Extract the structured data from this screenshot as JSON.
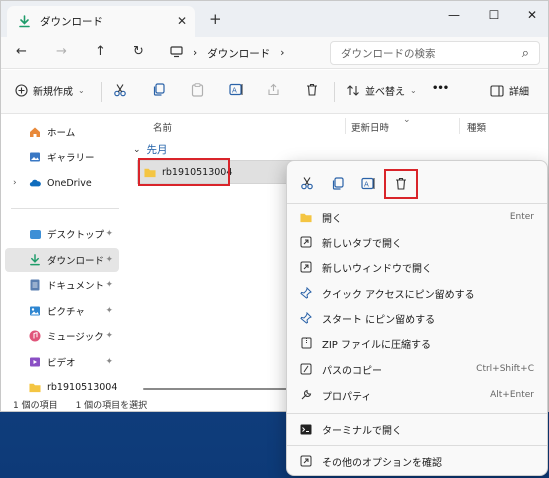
{
  "titlebar": {
    "tab_label": "ダウンロード",
    "tab_close": "✕",
    "new_tab": "+",
    "minimize": "—",
    "maximize": "☐",
    "close": "✕"
  },
  "addressbar": {
    "back": "←",
    "forward": "→",
    "up": "↑",
    "refresh": "↻",
    "crumb_sep1": "›",
    "crumb_location": "ダウンロード",
    "crumb_sep2": "›",
    "search_placeholder": "ダウンロードの検索",
    "search_icon": "⌕"
  },
  "commandbar": {
    "new_label": "新規作成",
    "sort_label": "並べ替え",
    "more": "•••",
    "details_label": "詳細"
  },
  "navpane": {
    "items": [
      {
        "label": "ホーム",
        "icon": "home-icon"
      },
      {
        "label": "ギャラリー",
        "icon": "gallery-icon"
      },
      {
        "label": "OneDrive",
        "icon": "onedrive-icon"
      },
      {
        "label": "デスクトップ",
        "icon": "desktop-icon"
      },
      {
        "label": "ダウンロード",
        "icon": "download-icon"
      },
      {
        "label": "ドキュメント",
        "icon": "documents-icon"
      },
      {
        "label": "ピクチャ",
        "icon": "pictures-icon"
      },
      {
        "label": "ミュージック",
        "icon": "music-icon"
      },
      {
        "label": "ビデオ",
        "icon": "videos-icon"
      },
      {
        "label": "rb1910513004",
        "icon": "folder-icon"
      }
    ],
    "expander": "›",
    "pin": "📌"
  },
  "content": {
    "columns": [
      "名前",
      "更新日時",
      "種類"
    ],
    "group_label": "先月",
    "group_chevron": "⌄",
    "files": [
      {
        "name": "rb1910513004",
        "icon": "folder-icon"
      }
    ]
  },
  "statusbar": {
    "item_count": "1 個の項目",
    "selected": "1 個の項目を選択"
  },
  "context_menu": {
    "quick_actions": [
      "cut-icon",
      "copy-icon",
      "rename-icon",
      "delete-icon"
    ],
    "items": [
      {
        "label": "開く",
        "shortcut": "Enter",
        "icon": "folder-open-icon"
      },
      {
        "label": "新しいタブで開く",
        "shortcut": "",
        "icon": "new-tab-icon"
      },
      {
        "label": "新しいウィンドウで開く",
        "shortcut": "",
        "icon": "new-window-icon"
      },
      {
        "label": "クイック アクセスにピン留めする",
        "shortcut": "",
        "icon": "pin-icon"
      },
      {
        "label": "スタート にピン留めする",
        "shortcut": "",
        "icon": "pin-start-icon"
      },
      {
        "label": "ZIP ファイルに圧縮する",
        "shortcut": "",
        "icon": "zip-icon"
      },
      {
        "label": "パスのコピー",
        "shortcut": "Ctrl+Shift+C",
        "icon": "copy-path-icon"
      },
      {
        "label": "プロパティ",
        "shortcut": "Alt+Enter",
        "icon": "properties-icon"
      },
      {
        "label": "ターミナルで開く",
        "shortcut": "",
        "icon": "terminal-icon"
      },
      {
        "label": "その他のオプションを確認",
        "shortcut": "",
        "icon": "more-options-icon"
      }
    ]
  },
  "colors": {
    "accent": "#0067c0",
    "folder": "#f4c542",
    "highlight": "#d9242a",
    "desktop_bg": "#0d3a78"
  }
}
